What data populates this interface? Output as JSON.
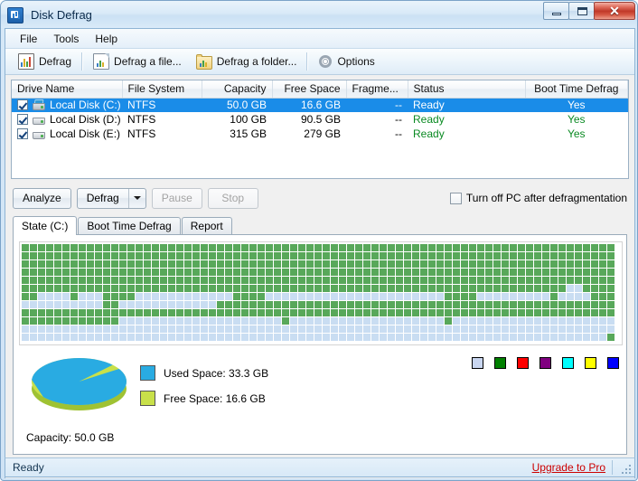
{
  "window": {
    "title": "Disk Defrag",
    "app_icon": "disk-defrag-icon",
    "buttons": {
      "minimize": "minimize-icon",
      "maximize": "maximize-icon",
      "close": "✕"
    }
  },
  "menu": {
    "items": [
      {
        "label": "File"
      },
      {
        "label": "Tools"
      },
      {
        "label": "Help"
      }
    ]
  },
  "toolbar": {
    "items": [
      {
        "label": "Defrag",
        "icon": "bar-chart-icon"
      },
      {
        "label": "Defrag a file...",
        "icon": "document-icon"
      },
      {
        "label": "Defrag a folder...",
        "icon": "folder-icon"
      },
      {
        "label": "Options",
        "icon": "gear-icon"
      }
    ]
  },
  "drive_table": {
    "columns": [
      "Drive Name",
      "File System",
      "Capacity",
      "Free Space",
      "Fragme...",
      "Status",
      "Boot Time Defrag"
    ],
    "rows": [
      {
        "checked": true,
        "selected": true,
        "icon": "system-drive-icon",
        "name": "Local Disk (C:)",
        "file_system": "NTFS",
        "capacity": "50.0 GB",
        "free_space": "16.6 GB",
        "fragmentation": "--",
        "status": "Ready",
        "boot_time_defrag": "Yes"
      },
      {
        "checked": true,
        "selected": false,
        "icon": "drive-icon",
        "name": "Local Disk (D:)",
        "file_system": "NTFS",
        "capacity": "100 GB",
        "free_space": "90.5 GB",
        "fragmentation": "--",
        "status": "Ready",
        "boot_time_defrag": "Yes"
      },
      {
        "checked": true,
        "selected": false,
        "icon": "drive-icon",
        "name": "Local Disk (E:)",
        "file_system": "NTFS",
        "capacity": "315 GB",
        "free_space": "279 GB",
        "fragmentation": "--",
        "status": "Ready",
        "boot_time_defrag": "Yes"
      }
    ]
  },
  "actions": {
    "analyze": "Analyze",
    "defrag": "Defrag",
    "defrag_dropdown": "chevron-down-icon",
    "pause": "Pause",
    "stop": "Stop",
    "turn_off_label": "Turn off PC after defragmentation",
    "turn_off_checked": false
  },
  "tabs": [
    {
      "label": "State (C:)",
      "active": true
    },
    {
      "label": "Boot Time Defrag",
      "active": false
    },
    {
      "label": "Report",
      "active": false
    }
  ],
  "disk_map": {
    "used_color": "#58a85a",
    "free_color": "#c9ddf2",
    "columns": 73,
    "rows": [
      "UUUUUUUUUUUUUUUUUUUUUUUUUUUUUUUUUUUUUUUUUUUUUUUUUUUUUUUUUUUUUUUUUUUUUUUUU",
      "UUUUUUUUUUUUUUUUUUUUUUUUUUUUUUUUUUUUUUUUUUUUUUUUUUUUUUUUUUUUUUUUUUUUUUUUU",
      "UUUUUUUUUUUUUUUUUUUUUUUUUUUUUUUUUUUUUUUUUUUUUUUUUUUUUUUUUUUUUUUUUUUUUUUUU",
      "UUUUUUUUUUUUUUUUUUUUUUUUUUUUUUUUUUUUUUUUUUUUUUUUUUUUUUUUUUUUUUUUUUUUUUUUU",
      "UUUUUUUUUUUUUUUUUUUUUUUUUUUUUUUUUUUUUUUUUUUUUUUUUUUUUUUUUUUUUUUUUUUUUUUUU",
      "UUUUUUUUUUUUUUUUUUUUUUUUUUUUUUUUUUUUUUUUUUUUUUUUUUUUUUUUUUUUUUUUUUUFFUUUU",
      "UUFFFFUFFFUUUUFFFFFFFFFFFFUUUUFFFFFFFFFFFFFFFFFFFFFFUUUUFFFFFFFFFUFFFFUUUU",
      "FFFFFFFFFFUUFFFFFFFFFFFFUUUUUUUUUUUUUUUUUUUUUUUUUUUUUUUUUUUUUUUUUUUUUUUUU",
      "UUUUUUUUUUUUUUUUUUUUUUUUUUUUUUUUUUUUUUUUUUUUUUUUUUUUUUUUUUUUUUUUUUUUUUUUU",
      "UUUUUUUUUUUUFFFFFFFFFFFFFFFFFFFFUFFFFFFFFFFFFFFFFFFFUFFFFFFFFFFFFFFFFFFFF",
      "FFFFFFFFFFFFFFFFFFFFFFFFFFFFFFFFFFFFFFFFFFFFFFFFFFFFFFFFFFFFFFFFFFFFFFFFF",
      "FFFFFFFFFFFFFFFFFFFFFFFFFFFFFFFFFFFFFFFFFFFFFFFFFFFFFFFFFFFFFFFFFFFFFFFFU"
    ]
  },
  "chart_data": {
    "type": "pie",
    "title": "",
    "categories": [
      "Used Space",
      "Free Space"
    ],
    "values": [
      33.3,
      16.6
    ],
    "unit": "GB",
    "labels": [
      "Used Space: 33.3 GB",
      "Free Space: 16.6 GB"
    ],
    "colors": [
      "#29abe2",
      "#c8e04a"
    ],
    "total_label": "Capacity: 50.0 GB",
    "legend_position": "right"
  },
  "legend": {
    "used": "Used Space: 33.3 GB",
    "free": "Free Space: 16.6 GB",
    "capacity": "Capacity: 50.0 GB",
    "used_color": "#29abe2",
    "free_color": "#c8e04a"
  },
  "swatches": [
    {
      "name": "swatch-lavender",
      "color": "#c9d6f0"
    },
    {
      "name": "swatch-green",
      "color": "#008000"
    },
    {
      "name": "swatch-red",
      "color": "#ff0000"
    },
    {
      "name": "swatch-purple",
      "color": "#800080"
    },
    {
      "name": "swatch-cyan",
      "color": "#00ffff"
    },
    {
      "name": "swatch-yellow",
      "color": "#ffff00"
    },
    {
      "name": "swatch-blue",
      "color": "#0000ff"
    }
  ],
  "status_bar": {
    "text": "Ready",
    "upgrade_link": "Upgrade to Pro"
  }
}
